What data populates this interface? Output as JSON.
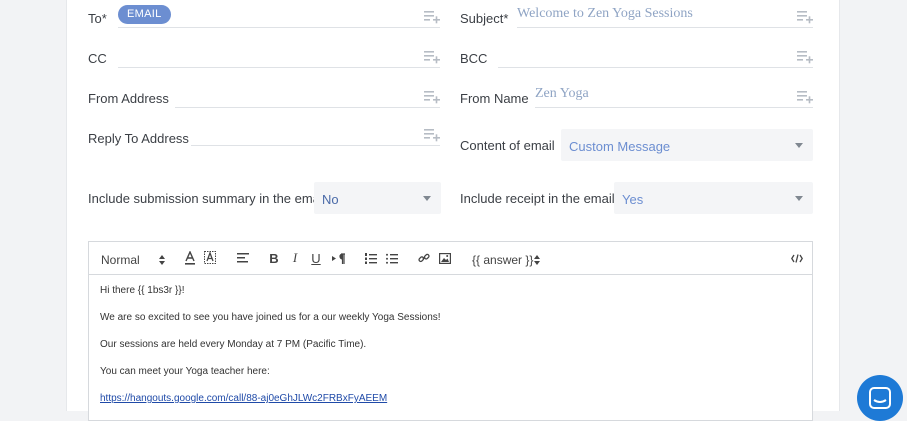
{
  "to": {
    "label": "To*",
    "chip": "EMAIL"
  },
  "subject": {
    "label": "Subject*",
    "value": "Welcome to Zen Yoga Sessions"
  },
  "cc": {
    "label": "CC"
  },
  "bcc": {
    "label": "BCC"
  },
  "from_address": {
    "label": "From Address"
  },
  "from_name": {
    "label": "From Name",
    "value": "Zen Yoga"
  },
  "reply_to": {
    "label": "Reply To Address"
  },
  "content_of_email": {
    "label": "Content of email",
    "value": "Custom Message"
  },
  "include_summary": {
    "label": "Include submission summary in the email",
    "value": "No"
  },
  "include_receipt": {
    "label": "Include receipt in the email",
    "value": "Yes"
  },
  "toolbar": {
    "format": "Normal",
    "answer": "{{ answer }}",
    "icons": [
      "font-color-icon",
      "background-color-icon",
      "align-icon",
      "bold-icon",
      "italic-icon",
      "underline-icon",
      "text-direction-icon",
      "ordered-list-icon",
      "bullet-list-icon",
      "link-icon",
      "image-icon",
      "code-view-icon"
    ]
  },
  "body": {
    "line1": "Hi there {{ 1bs3r }}!",
    "line2": "We are so excited to see you have joined us for a our weekly Yoga Sessions!",
    "line3": "Our sessions are held every Monday at 7 PM (Pacific Time).",
    "line4": "You can meet your Yoga teacher here:",
    "link": "https://hangouts.google.com/call/88-aj0eGhJLWc2FRBxFyAEEM"
  },
  "colors": {
    "accent": "#6c8ed1",
    "chat": "#1e7ad6",
    "placeholder": "#8fa4c4"
  }
}
